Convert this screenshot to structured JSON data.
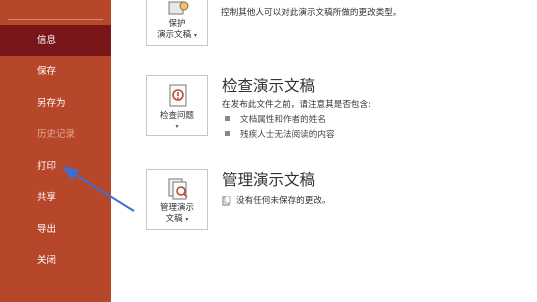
{
  "sidebar": {
    "items": [
      {
        "label": "信息",
        "state": "active"
      },
      {
        "label": "保存",
        "state": "normal"
      },
      {
        "label": "另存为",
        "state": "normal"
      },
      {
        "label": "历史记录",
        "state": "disabled"
      },
      {
        "label": "打印",
        "state": "normal"
      },
      {
        "label": "共享",
        "state": "normal"
      },
      {
        "label": "导出",
        "state": "normal"
      },
      {
        "label": "关闭",
        "state": "normal"
      }
    ]
  },
  "main": {
    "protect": {
      "button_line1": "保护",
      "button_line2": "演示文稿",
      "icon": "lock-key-icon",
      "description": "控制其他人可以对此演示文稿所做的更改类型。"
    },
    "inspect": {
      "title": "检查演示文稿",
      "button_line1": "检查问题",
      "icon": "check-document-icon",
      "intro": "在发布此文件之前，请注意其是否包含:",
      "bullets": [
        "文档属性和作者的姓名",
        "残疾人士无法阅读的内容"
      ]
    },
    "manage": {
      "title": "管理演示文稿",
      "button_line1": "管理演示",
      "button_line2": "文稿",
      "icon": "manage-document-icon",
      "note": "没有任何未保存的更改。"
    }
  },
  "colors": {
    "sidebar": "#b7472a",
    "sidebar_active": "#79161a",
    "annotation_arrow": "#3b6fd6"
  }
}
